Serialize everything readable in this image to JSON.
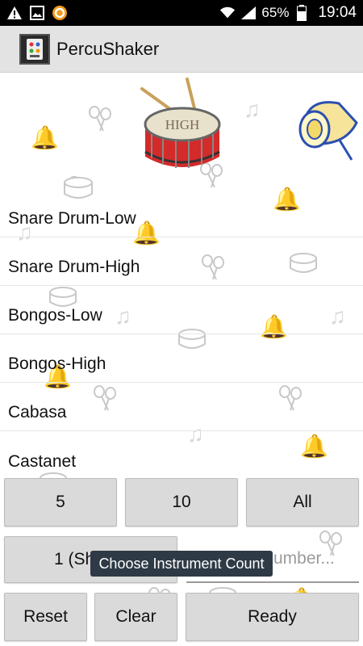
{
  "status_bar": {
    "battery_percent": "65%",
    "time": "19:04",
    "icons": [
      "warning-icon",
      "image-icon",
      "sync-icon",
      "wifi-icon",
      "signal-icon",
      "battery-icon"
    ]
  },
  "app": {
    "title": "PercuShaker"
  },
  "instruments": [
    {
      "label": "Snare Drum-Low"
    },
    {
      "label": "Snare Drum-High"
    },
    {
      "label": "Bongos-Low"
    },
    {
      "label": "Bongos-High"
    },
    {
      "label": "Cabasa"
    },
    {
      "label": "Castanet"
    }
  ],
  "header_art": {
    "drum_label": "HIGH"
  },
  "count_buttons": {
    "five": "5",
    "ten": "10",
    "all": "All"
  },
  "row2": {
    "shake_label": "1 (Sh",
    "number_placeholder": "umber..."
  },
  "toast": {
    "text": "Choose Instrument Count"
  },
  "bottom_buttons": {
    "reset": "Reset",
    "clear": "Clear",
    "ready": "Ready"
  },
  "colors": {
    "action_bar": "#e3e3e3",
    "button": "#dadada",
    "toast": "#2e3a45",
    "drum_red": "#d32a2a"
  }
}
